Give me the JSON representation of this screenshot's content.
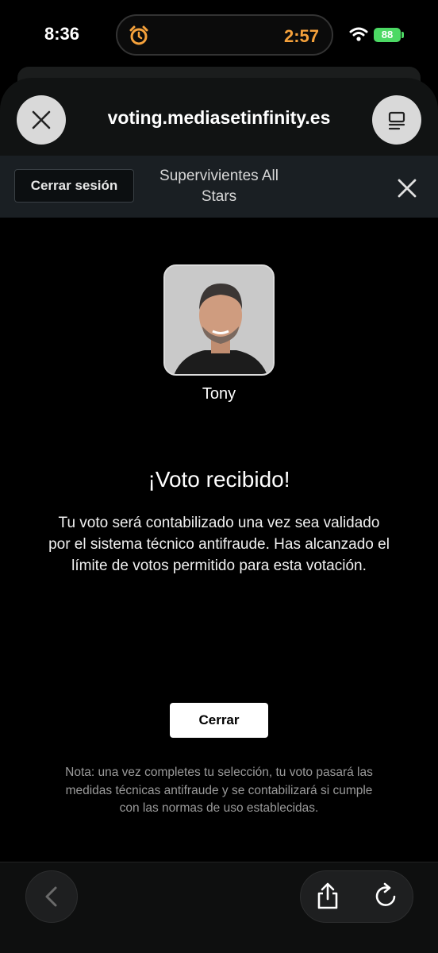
{
  "status_bar": {
    "time": "8:36",
    "timer": "2:57",
    "battery": "88"
  },
  "browser": {
    "url": "voting.mediasetinfinity.es",
    "close_icon": "close-icon",
    "menu_icon": "reader-menu-icon"
  },
  "topbar": {
    "logout_label": "Cerrar sesión",
    "program_title": "Supervivientes All Stars"
  },
  "candidate": {
    "name": "Tony"
  },
  "confirmation": {
    "title": "¡Voto recibido!",
    "message": "Tu voto será contabilizado una vez sea validado por el sistema técnico antifraude. Has alcanzado el límite de votos permitido para esta votación.",
    "close_label": "Cerrar",
    "note": "Nota: una vez completes tu selección, tu voto pasará las medidas técnicas antifraude y se contabilizará si cumple con las normas de uso establecidas."
  },
  "colors": {
    "timer": "#f5a13b",
    "battery": "#4cd964",
    "topbar_bg": "#1a1f23"
  }
}
